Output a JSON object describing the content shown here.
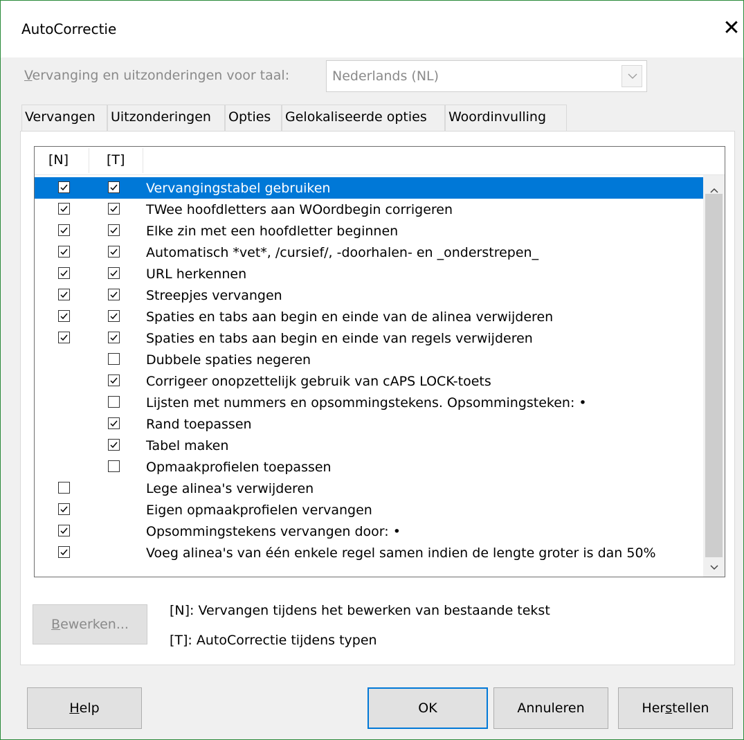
{
  "dialog": {
    "title": "AutoCorrectie"
  },
  "language": {
    "label": "Vervanging en uitzonderingen voor taal:",
    "value": "Nederlands (NL)"
  },
  "tabs": [
    {
      "label": "Vervangen",
      "active": false
    },
    {
      "label": "Uitzonderingen",
      "active": false
    },
    {
      "label": "Opties",
      "active": true
    },
    {
      "label": "Gelokaliseerde opties",
      "active": false
    },
    {
      "label": "Woordinvulling",
      "active": false
    }
  ],
  "options_list": {
    "col_n": "[N]",
    "col_t": "[T]",
    "rows": [
      {
        "label": "Vervangingstabel gebruiken",
        "n": true,
        "t": true,
        "selected": true
      },
      {
        "label": "TWee hoofdletters aan WOordbegin corrigeren",
        "n": true,
        "t": true
      },
      {
        "label": "Elke zin met een hoofdletter beginnen",
        "n": true,
        "t": true
      },
      {
        "label": "Automatisch *vet*, /cursief/, -doorhalen- en _onderstrepen_",
        "n": true,
        "t": true
      },
      {
        "label": "URL herkennen",
        "n": true,
        "t": true
      },
      {
        "label": "Streepjes vervangen",
        "n": true,
        "t": true
      },
      {
        "label": "Spaties en tabs aan begin en einde van de alinea verwijderen",
        "n": true,
        "t": true
      },
      {
        "label": "Spaties en tabs aan begin en einde van regels verwijderen",
        "n": true,
        "t": true
      },
      {
        "label": "Dubbele spaties negeren",
        "n": null,
        "t": false
      },
      {
        "label": "Corrigeer onopzettelijk gebruik van cAPS LOCK-toets",
        "n": null,
        "t": true
      },
      {
        "label": "Lijsten met nummers en opsommingstekens. Opsommingsteken: •",
        "n": null,
        "t": false
      },
      {
        "label": "Rand toepassen",
        "n": null,
        "t": true
      },
      {
        "label": "Tabel maken",
        "n": null,
        "t": true
      },
      {
        "label": "Opmaakprofielen toepassen",
        "n": null,
        "t": false
      },
      {
        "label": "Lege alinea's verwijderen",
        "n": false,
        "t": null
      },
      {
        "label": "Eigen opmaakprofielen vervangen",
        "n": true,
        "t": null
      },
      {
        "label": "Opsommingstekens vervangen door: •",
        "n": true,
        "t": null
      },
      {
        "label": "Voeg alinea's van één enkele regel samen indien de lengte groter is dan 50%",
        "n": true,
        "t": null
      }
    ]
  },
  "edit_button": "Bewerken...",
  "legend": {
    "n": "[N]: Vervangen tijdens het bewerken van bestaande tekst",
    "t": "[T]: AutoCorrectie tijdens typen"
  },
  "buttons": {
    "help": "Help",
    "ok": "OK",
    "cancel": "Annuleren",
    "reset": "Herstellen"
  },
  "colors": {
    "selection": "#0078d7",
    "window_border": "#2a8a3a"
  },
  "icons": {
    "close": "close-icon",
    "dropdown": "chevron-down-icon",
    "check": "checkmark-icon"
  }
}
